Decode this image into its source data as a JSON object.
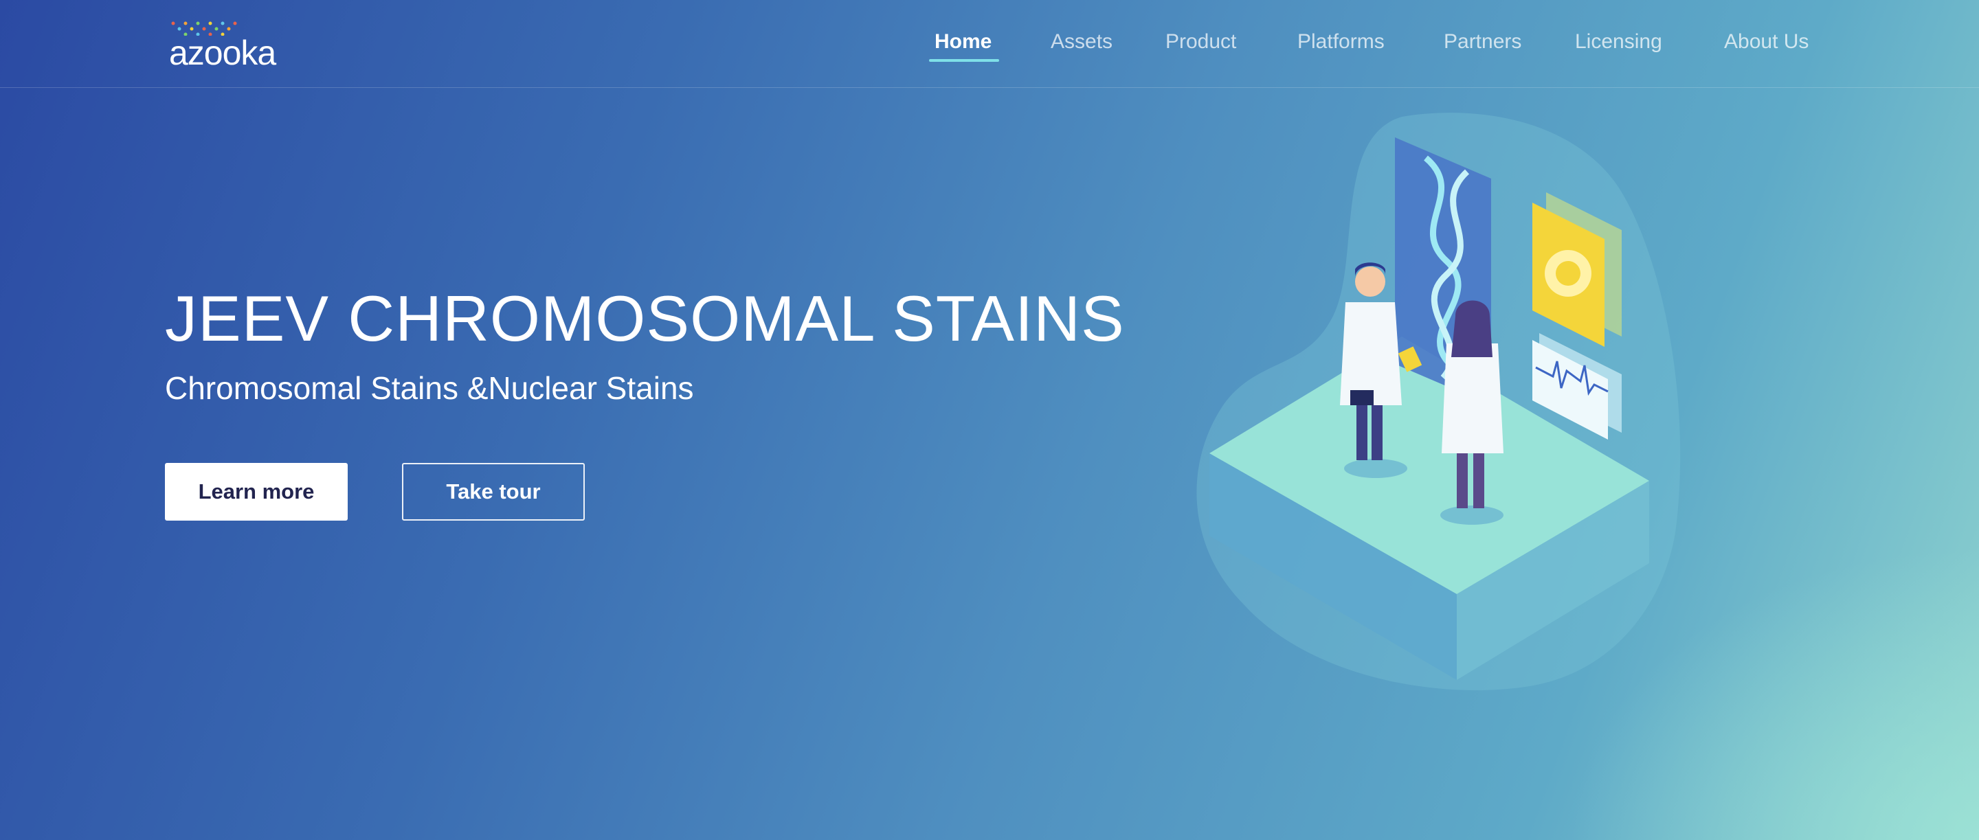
{
  "brand": {
    "logo_text": "azooka"
  },
  "nav": {
    "items": [
      {
        "label": "Home",
        "active": true
      },
      {
        "label": "Assets"
      },
      {
        "label": "Product"
      },
      {
        "label": "Platforms"
      },
      {
        "label": "Partners"
      },
      {
        "label": "Licensing"
      },
      {
        "label": "About Us"
      }
    ]
  },
  "hero": {
    "title": "JEEV CHROMOSOMAL STAINS",
    "subtitle": "Chromosomal Stains &Nuclear Stains",
    "primary_button": "Learn more",
    "secondary_button": "Take tour"
  },
  "colors": {
    "accent_underline": "#7fe0e8",
    "primary_button_text": "#22244f"
  }
}
